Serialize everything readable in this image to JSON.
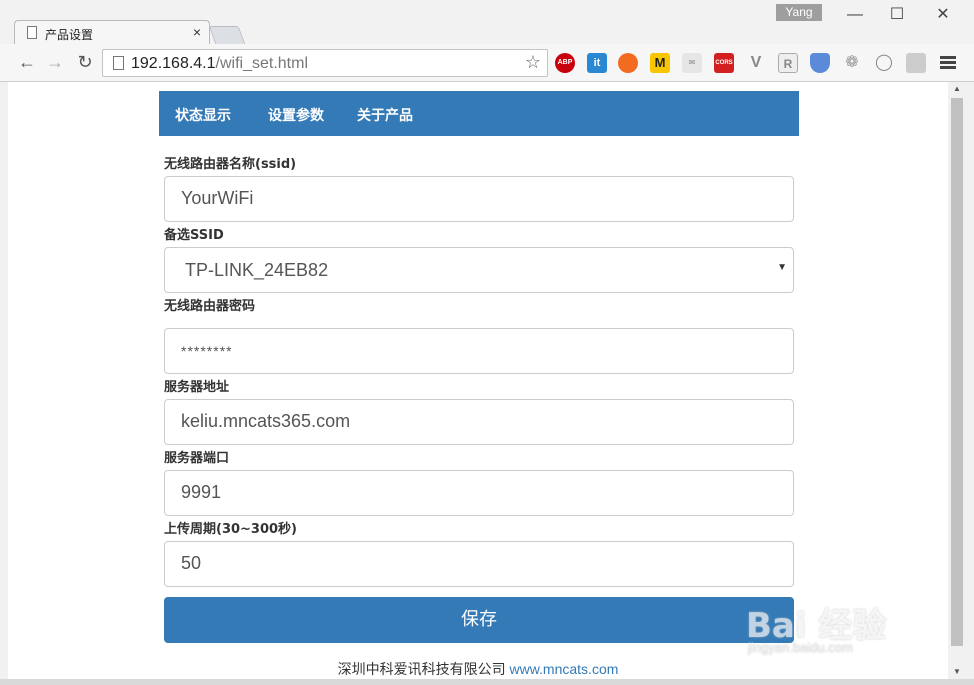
{
  "browser": {
    "tab_title": "产品设置",
    "tab_close": "×",
    "user_badge": "Yang",
    "window_min": "—",
    "window_max": "☐",
    "window_close": "✕",
    "url_host": "192.168.4.1",
    "url_path": "/wifi_set.html",
    "extensions": [
      "ABP",
      "it",
      "",
      "M",
      "",
      "CORS",
      "V",
      "R",
      "",
      "",
      "",
      ""
    ]
  },
  "nav": {
    "items": [
      "状态显示",
      "设置参数",
      "关于产品"
    ]
  },
  "form": {
    "ssid_label": "无线路由器名称(ssid)",
    "ssid_value": "YourWiFi",
    "alt_ssid_label": "备选SSID",
    "alt_ssid_selected": "TP-LINK_24EB82",
    "password_label": "无线路由器密码",
    "password_value": "********",
    "server_label": "服务器地址",
    "server_value": "keliu.mncats365.com",
    "port_label": "服务器端口",
    "port_value": "9991",
    "period_label": "上传周期(30~300秒)",
    "period_value": "50",
    "save_label": "保存"
  },
  "footer": {
    "company": "深圳中科爱讯科技有限公司",
    "website": "www.mncats.com"
  },
  "watermark": {
    "brand": "Bai 经验",
    "url": "jingyan.baidu.com"
  },
  "colors": {
    "primary": "#337ab7",
    "input_border": "#cccccc"
  }
}
